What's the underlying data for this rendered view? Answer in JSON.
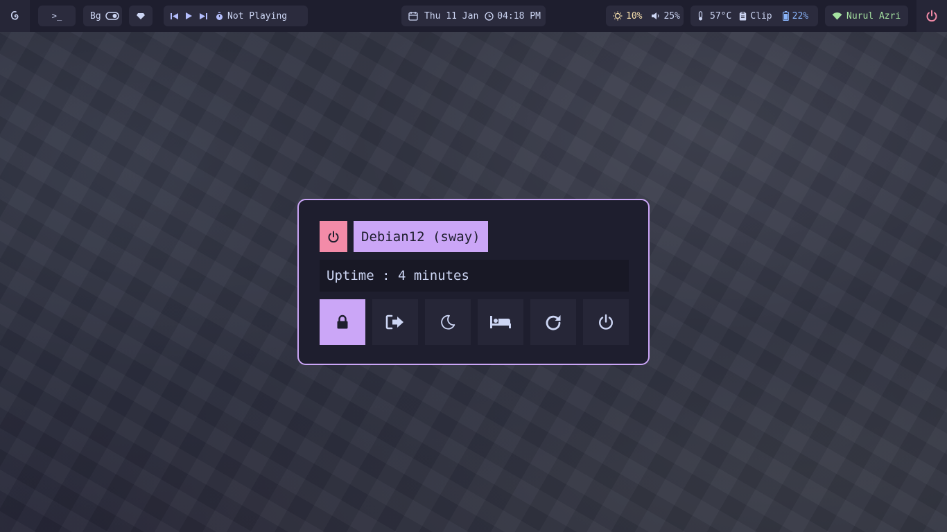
{
  "colors": {
    "bar_bg": "#1e1e2e",
    "pill_bg": "#2b2b3d",
    "accent": "#cba6f7",
    "danger": "#f38ba8",
    "text": "#cdd6f4",
    "warning": "#f9e2af",
    "success": "#a6e3a1",
    "info": "#89b4fa"
  },
  "topbar": {
    "logo_icon": "debian-swirl-icon",
    "terminal_label": ">_",
    "bg_toggle_label": "Bg",
    "media_status": "Not Playing",
    "date": "Thu 11 Jan",
    "time": "04:18 PM",
    "brightness": "10%",
    "volume": "25%",
    "temperature": "57°C",
    "clipboard_label": "Clip",
    "battery": "22%",
    "wifi_name": "Nurul Azri"
  },
  "dialog": {
    "host_label": "Debian12 (sway)",
    "uptime": "Uptime : 4 minutes",
    "actions": [
      {
        "name": "lock",
        "icon": "lock-icon",
        "active": true
      },
      {
        "name": "logout",
        "icon": "logout-icon",
        "active": false
      },
      {
        "name": "suspend",
        "icon": "moon-icon",
        "active": false
      },
      {
        "name": "hibernate",
        "icon": "bed-icon",
        "active": false
      },
      {
        "name": "reboot",
        "icon": "reboot-icon",
        "active": false
      },
      {
        "name": "shutdown",
        "icon": "power-icon",
        "active": false
      }
    ]
  }
}
